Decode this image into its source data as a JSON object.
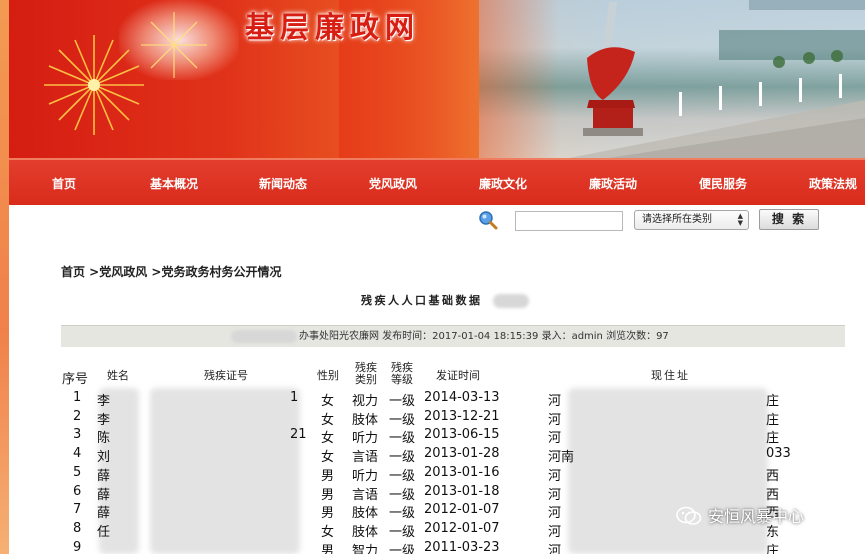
{
  "site": {
    "title": "基层廉政网"
  },
  "nav": {
    "items": [
      {
        "label": "首页"
      },
      {
        "label": "基本概况"
      },
      {
        "label": "新闻动态"
      },
      {
        "label": "党风政风"
      },
      {
        "label": "廉政文化"
      },
      {
        "label": "廉政活动"
      },
      {
        "label": "便民服务"
      },
      {
        "label": "政策法规"
      }
    ]
  },
  "search": {
    "icon": "search-icon",
    "value": "",
    "category_selected": "请选择所在类别",
    "button_label": "搜 索"
  },
  "breadcrumb": "首页 >党风政风 >党务政务村务公开情况",
  "article": {
    "title": "残疾人人口基础数据",
    "meta": "办事处阳光农廉网 发布时间：2017-01-04 18:15:39 录入：admin 浏览次数：97"
  },
  "table": {
    "headers": {
      "seq": "序号",
      "name": "姓名",
      "cert_no": "残疾证号",
      "gender": "性别",
      "disability_type": [
        "残疾",
        "类别"
      ],
      "disability_level": [
        "残疾",
        "等级"
      ],
      "issue_date": "发证时间",
      "address": "现住址"
    },
    "rows": [
      {
        "seq": "1",
        "name": "李",
        "cert_tail": "1",
        "gender": "女",
        "type": "视力",
        "level": "一级",
        "date": "2014-03-13",
        "addr_head": "河",
        "addr_tail": "庄"
      },
      {
        "seq": "2",
        "name": "李",
        "cert_tail": "",
        "gender": "女",
        "type": "肢体",
        "level": "一级",
        "date": "2013-12-21",
        "addr_head": "河",
        "addr_tail": "庄"
      },
      {
        "seq": "3",
        "name": "陈",
        "cert_tail": "21",
        "gender": "女",
        "type": "听力",
        "level": "一级",
        "date": "2013-06-15",
        "addr_head": "河",
        "addr_tail": "庄"
      },
      {
        "seq": "4",
        "name": "刘",
        "cert_tail": "",
        "gender": "女",
        "type": "言语",
        "level": "一级",
        "date": "2013-01-28",
        "addr_head": "河南",
        "addr_tail": "033"
      },
      {
        "seq": "5",
        "name": "薛",
        "cert_tail": "",
        "gender": "男",
        "type": "听力",
        "level": "一级",
        "date": "2013-01-16",
        "addr_head": "河",
        "addr_tail": "西"
      },
      {
        "seq": "6",
        "name": "薛",
        "cert_tail": "",
        "gender": "男",
        "type": "言语",
        "level": "一级",
        "date": "2013-01-18",
        "addr_head": "河",
        "addr_tail": "西"
      },
      {
        "seq": "7",
        "name": "薛",
        "cert_tail": "",
        "gender": "男",
        "type": "肢体",
        "level": "一级",
        "date": "2012-01-07",
        "addr_head": "河",
        "addr_tail": "西"
      },
      {
        "seq": "8",
        "name": "任",
        "cert_tail": "",
        "gender": "女",
        "type": "肢体",
        "level": "一级",
        "date": "2012-01-07",
        "addr_head": "河",
        "addr_tail": "东"
      },
      {
        "seq": "9",
        "name": "",
        "cert_tail": "",
        "gender": "男",
        "type": "智力",
        "level": "一级",
        "date": "2011-03-23",
        "addr_head": "河",
        "addr_tail": "庄"
      }
    ]
  },
  "watermark": {
    "text": "安恒风暴中心",
    "icon": "wechat-icon"
  },
  "colors": {
    "nav_bg": "#d92b1c",
    "banner_red": "#d51d12",
    "title_red": "#d81d12",
    "meta_bar": "#e6e6e1"
  }
}
